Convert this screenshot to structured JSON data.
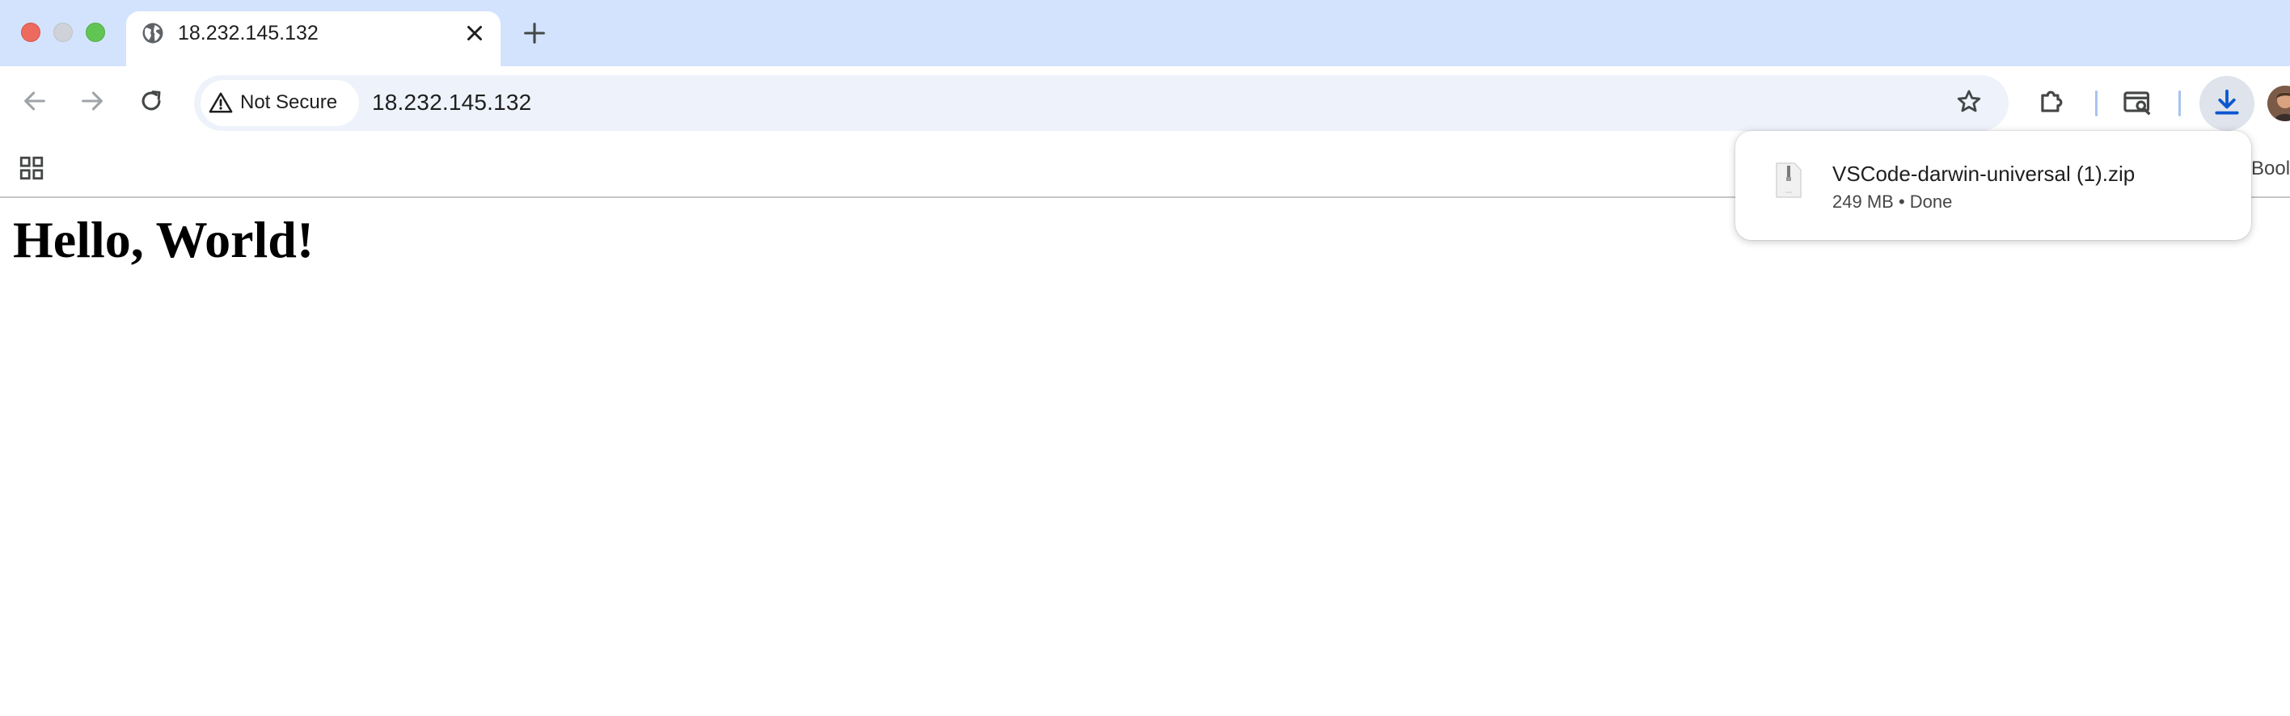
{
  "tab": {
    "title": "18.232.145.132",
    "favicon": "globe-icon"
  },
  "toolbar": {
    "security_label": "Not Secure",
    "url": "18.232.145.132"
  },
  "page": {
    "heading": "Hello, World!"
  },
  "bookmarks_bar": {
    "truncated_label": "Bool"
  },
  "downloads": {
    "items": [
      {
        "name": "VSCode-darwin-universal (1).zip",
        "size": "249 MB",
        "separator": "•",
        "status": "Done"
      }
    ]
  },
  "colors": {
    "tabstrip": "#d3e3fd",
    "omnibox": "#eef2fa",
    "download_accent": "#0b57d0"
  }
}
